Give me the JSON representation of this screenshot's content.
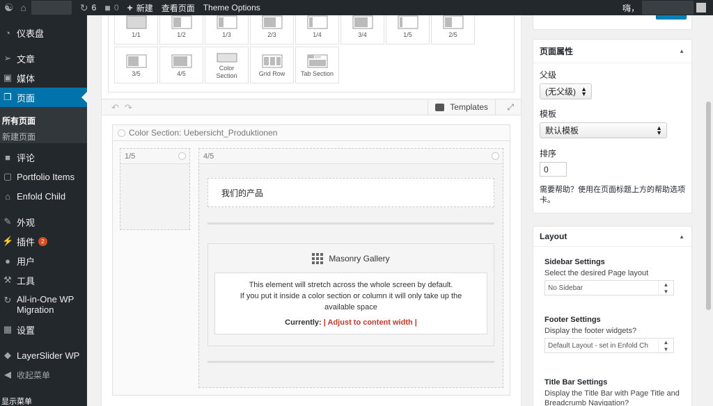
{
  "adminbar": {
    "updates_count": "6",
    "comments_count": "0",
    "new_label": "新建",
    "view_page": "查看页面",
    "theme_options": "Theme Options",
    "greeting": "嗨，"
  },
  "sidebar": {
    "items": [
      {
        "label": "仪表盘",
        "icon": "dashboard-icon"
      },
      {
        "label": "文章",
        "icon": "pin-icon"
      },
      {
        "label": "媒体",
        "icon": "media-icon"
      },
      {
        "label": "页面",
        "icon": "pages-icon"
      },
      {
        "label": "评论",
        "icon": "comment-icon"
      },
      {
        "label": "Portfolio Items",
        "icon": "portfolio-icon"
      },
      {
        "label": "Enfold Child",
        "icon": "home-icon"
      },
      {
        "label": "外观",
        "icon": "brush-icon"
      },
      {
        "label": "插件",
        "icon": "plugin-icon",
        "badge": "2"
      },
      {
        "label": "用户",
        "icon": "user-icon"
      },
      {
        "label": "工具",
        "icon": "wrench-icon"
      },
      {
        "label": "All-in-One WP Migration",
        "icon": "migration-icon"
      },
      {
        "label": "设置",
        "icon": "settings-icon"
      },
      {
        "label": "LayerSlider WP",
        "icon": "layerslider-icon"
      },
      {
        "label": "收起菜单",
        "icon": "collapse-icon"
      }
    ],
    "submenu": [
      "所有页面",
      "新建页面"
    ],
    "show_menu": "显示菜单"
  },
  "builder": {
    "shortcuts": [
      "1/1",
      "1/2",
      "1/3",
      "2/3",
      "1/4",
      "3/4",
      "1/5",
      "2/5",
      "3/5",
      "4/5",
      "Color Section",
      "Grid Row",
      "Tab Section"
    ],
    "templates_label": "Templates",
    "color_section_title": "Color Section: Uebersicht_Produktionen",
    "col_small_label": "1/5",
    "col_large_label": "4/5",
    "heading_text": "我们的产品",
    "gallery_title": "Masonry Gallery",
    "gallery_line1": "This element will stretch across the whole screen by default.",
    "gallery_line2": "If you put it inside a color section or column it will only take up the available space",
    "currently_label": "Currently:",
    "currently_value": "| Adjust to content width |"
  },
  "page_attributes": {
    "title": "页面属性",
    "parent_label": "父级",
    "parent_value": "(无父级)",
    "template_label": "模板",
    "template_value": "默认模板",
    "order_label": "排序",
    "order_value": "0",
    "help_text": "需要帮助？使用在页面标题上方的帮助选项卡。"
  },
  "layout_box": {
    "title": "Layout",
    "sidebar_title": "Sidebar Settings",
    "sidebar_desc": "Select the desired Page layout",
    "sidebar_value": "No Sidebar",
    "footer_title": "Footer Settings",
    "footer_desc": "Display the footer widgets?",
    "footer_value": "Default Layout - set in Enfold Ch",
    "titlebar_title": "Title Bar Settings",
    "titlebar_desc": "Display the Title Bar with Page Title and Breadcrumb Navigation?"
  },
  "colors": {
    "admin_dark": "#23282d",
    "accent_blue": "#0073aa",
    "warning_red": "#c0392b"
  }
}
